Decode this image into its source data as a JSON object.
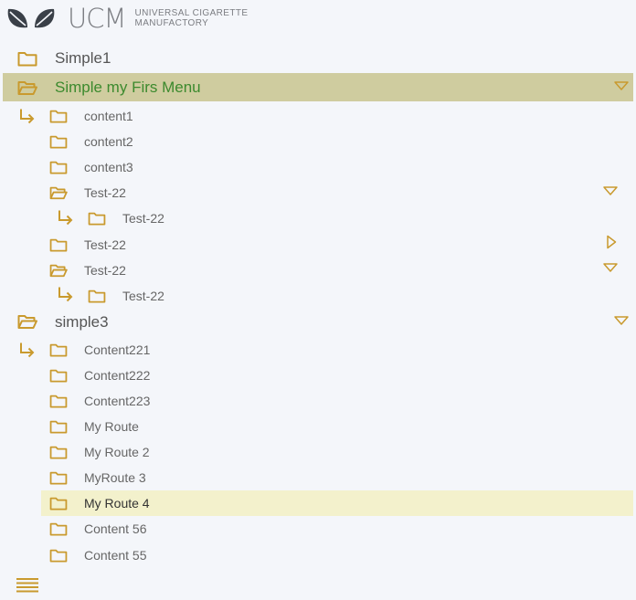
{
  "brand": {
    "abbr": "UCM",
    "name_line1": "UNIVERSAL CIGARETTE",
    "name_line2": "MANUFACTORY"
  },
  "colors": {
    "folder": "#c99a2e",
    "active_menu_bg": "#cfcc9f",
    "active_menu_text": "#3c8a2e",
    "selected_bg": "#f3f1cc",
    "leaf_dark": "#3a4048"
  },
  "menu": {
    "simple1": "Simple1",
    "simple_my_first": "Simple my Firs Menu",
    "content1": "content1",
    "content2": "content2",
    "content3": "content3",
    "test22_a": "Test-22",
    "test22_a_child": "Test-22",
    "test22_b": "Test-22",
    "test22_c": "Test-22",
    "test22_c_child": "Test-22",
    "simple3": "simple3",
    "content221": "Content221",
    "content222": "Content222",
    "content223": "Content223",
    "my_route": "My Route",
    "my_route2": "My Route 2",
    "my_route3": "MyRoute 3",
    "my_route4": "My Route 4",
    "content56": "Content 56",
    "content55": "Content 55"
  },
  "icons": [
    "folder-closed-icon",
    "folder-open-icon",
    "child-arrow-icon",
    "chevron-down-icon",
    "chevron-right-icon",
    "hamburger-menu-icon"
  ]
}
